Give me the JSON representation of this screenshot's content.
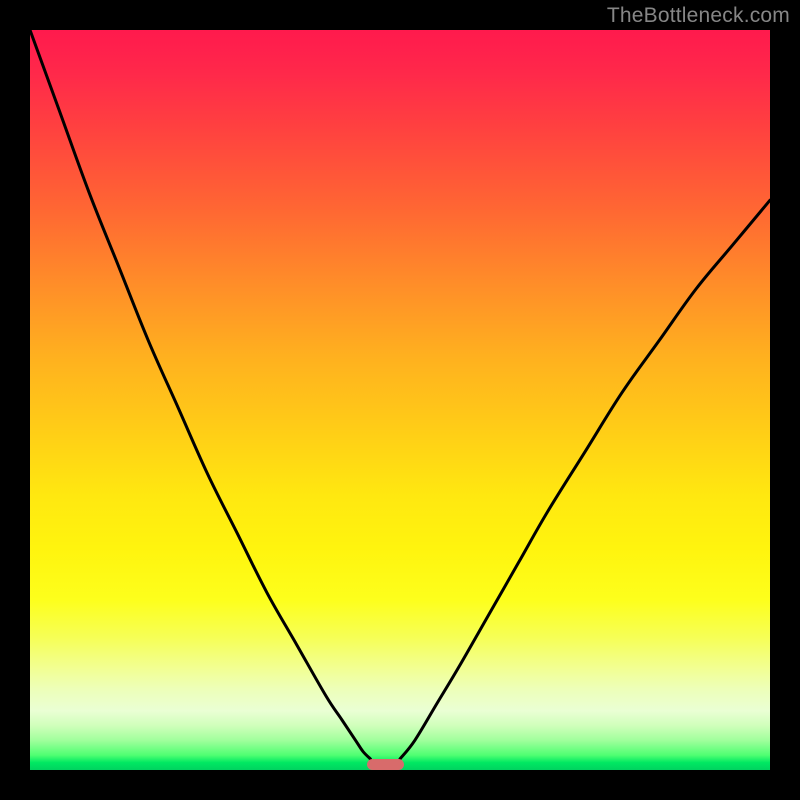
{
  "watermark": "TheBottleneck.com",
  "chart_data": {
    "type": "line",
    "title": "",
    "xlabel": "",
    "ylabel": "",
    "xlim": [
      0,
      100
    ],
    "ylim": [
      0,
      100
    ],
    "grid": false,
    "gradient_stops": [
      {
        "pct": 0,
        "color": "#ff1a4d"
      },
      {
        "pct": 24,
        "color": "#ff6633"
      },
      {
        "pct": 55,
        "color": "#ffd016"
      },
      {
        "pct": 77,
        "color": "#fdff1c"
      },
      {
        "pct": 92,
        "color": "#eaffd4"
      },
      {
        "pct": 100,
        "color": "#00d260"
      }
    ],
    "series": [
      {
        "name": "left-curve",
        "x": [
          0,
          4,
          8,
          12,
          16,
          20,
          24,
          28,
          32,
          36,
          40,
          42,
          44,
          45,
          46
        ],
        "values": [
          100,
          89,
          78,
          68,
          58,
          49,
          40,
          32,
          24,
          17,
          10,
          7,
          4,
          2.5,
          1.5
        ]
      },
      {
        "name": "right-curve",
        "x": [
          50,
          52,
          55,
          58,
          62,
          66,
          70,
          75,
          80,
          85,
          90,
          95,
          100
        ],
        "values": [
          1.5,
          4,
          9,
          14,
          21,
          28,
          35,
          43,
          51,
          58,
          65,
          71,
          77
        ]
      }
    ],
    "marker": {
      "name": "bottleneck-marker",
      "x_center": 48,
      "width": 5,
      "y": 0.8,
      "color": "#d86b6b"
    }
  }
}
